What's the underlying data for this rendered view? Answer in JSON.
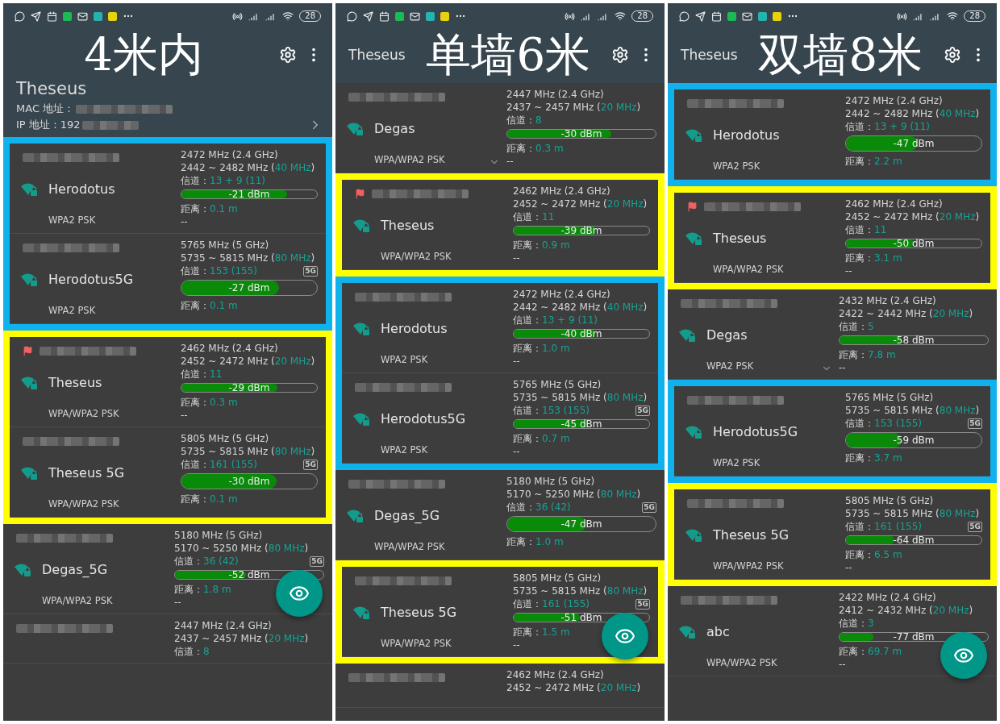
{
  "panels": [
    {
      "caption": "4米内",
      "status_bar": {
        "battery": "28"
      },
      "header": {
        "kind": "expanded",
        "title": "Theseus",
        "mac": "MAC 地址：",
        "ip": "IP 地址：192"
      },
      "groups": [
        {
          "color": "#10b2ee",
          "networks": [
            {
              "kind": "full",
              "flagged": false,
              "expandable": false,
              "name": "Herodotus",
              "security": "WPA2 PSK",
              "frequency": "2472 MHz (2.4 GHz)",
              "range": {
                "start": "2442 ~ 2482 MHz (",
                "bandwidth": "40 MHz",
                "end": ")"
              },
              "channel": {
                "label": "信道：",
                "value": "13 + 9 (11)"
              },
              "signal": {
                "level": 0.78,
                "reading": "-21 dBm"
              },
              "distance": {
                "label": "距离：",
                "value": "0.1 m"
              },
              "note": "--"
            },
            {
              "kind": "full",
              "flagged": false,
              "expandable": false,
              "name": "Herodotus5G",
              "security": "WPA2 PSK",
              "frequency": "5765 MHz (5 GHz)",
              "range": {
                "start": "5735 ~ 5815 MHz (",
                "bandwidth": "80 MHz",
                "end": ")"
              },
              "channel": {
                "label": "信道：",
                "value": "153 (155)"
              },
              "badge": "5G",
              "signal": {
                "level": 0.72,
                "reading": "-27 dBm"
              },
              "distance": {
                "label": "距离：",
                "value": "0.1 m"
              }
            }
          ]
        },
        {
          "color": "#ffff00",
          "networks": [
            {
              "kind": "full",
              "flagged": true,
              "expandable": false,
              "name": "Theseus",
              "security": "WPA/WPA2 PSK",
              "frequency": "2462 MHz (2.4 GHz)",
              "range": {
                "start": "2452 ~ 2472 MHz (",
                "bandwidth": "20 MHz",
                "end": ")"
              },
              "channel": {
                "label": "信道：",
                "value": "11"
              },
              "signal": {
                "level": 0.71,
                "reading": "-29 dBm"
              },
              "distance": {
                "label": "距离：",
                "value": "0.3 m"
              },
              "note": "--"
            },
            {
              "kind": "full",
              "flagged": false,
              "expandable": false,
              "name": "Theseus 5G",
              "security": "WPA/WPA2 PSK",
              "frequency": "5805 MHz (5 GHz)",
              "range": {
                "start": "5735 ~ 5815 MHz (",
                "bandwidth": "80 MHz",
                "end": ")"
              },
              "channel": {
                "label": "信道：",
                "value": "161 (155)"
              },
              "badge": "5G",
              "signal": {
                "level": 0.7,
                "reading": "-30 dBm"
              },
              "distance": {
                "label": "距离：",
                "value": "0.1 m"
              }
            }
          ]
        },
        {
          "networks": [
            {
              "kind": "full",
              "flagged": false,
              "expandable": false,
              "name": "Degas_5G",
              "security": "WPA/WPA2 PSK",
              "frequency": "5180 MHz (5 GHz)",
              "range": {
                "start": "5170 ~ 5250 MHz (",
                "bandwidth": "80 MHz",
                "end": ")"
              },
              "channel": {
                "label": "信道：",
                "value": "36 (42)"
              },
              "badge": "5G",
              "signal": {
                "level": 0.48,
                "reading": "-52 dBm"
              },
              "distance": {
                "label": "距离：",
                "value": "1.8 m"
              },
              "note": "--"
            },
            {
              "kind": "partial",
              "flagged": false,
              "expandable": false,
              "frequency": "2447 MHz (2.4 GHz)",
              "range": {
                "start": "2437 ~ 2457 MHz (",
                "bandwidth": "20 MHz",
                "end": ")"
              },
              "channel": {
                "label": "信道：",
                "value": "8"
              }
            }
          ]
        }
      ]
    },
    {
      "caption": "单墙6米",
      "status_bar": {
        "battery": "28"
      },
      "header": {
        "kind": "collapsed",
        "title": "Theseus"
      },
      "groups": [
        {
          "networks": [
            {
              "kind": "full",
              "flagged": false,
              "expandable": true,
              "name": "Degas",
              "security": "WPA/WPA2 PSK",
              "frequency": "2447 MHz (2.4 GHz)",
              "range": {
                "start": "2437 ~ 2457 MHz (",
                "bandwidth": "20 MHz",
                "end": ")"
              },
              "channel": {
                "label": "信道：",
                "value": "8"
              },
              "signal": {
                "level": 0.7,
                "reading": "-30 dBm"
              },
              "distance": {
                "label": "距离：",
                "value": "0.3 m"
              },
              "note": "--"
            }
          ]
        },
        {
          "color": "#ffff00",
          "networks": [
            {
              "kind": "full",
              "flagged": true,
              "expandable": false,
              "name": "Theseus",
              "security": "WPA/WPA2 PSK",
              "frequency": "2462 MHz (2.4 GHz)",
              "range": {
                "start": "2452 ~ 2472 MHz (",
                "bandwidth": "20 MHz",
                "end": ")"
              },
              "channel": {
                "label": "信道：",
                "value": "11"
              },
              "signal": {
                "level": 0.61,
                "reading": "-39 dBm"
              },
              "distance": {
                "label": "距离：",
                "value": "0.9 m"
              },
              "note": "--"
            }
          ]
        },
        {
          "color": "#10b2ee",
          "networks": [
            {
              "kind": "full",
              "flagged": false,
              "expandable": false,
              "name": "Herodotus",
              "security": "WPA2 PSK",
              "frequency": "2472 MHz (2.4 GHz)",
              "range": {
                "start": "2442 ~ 2482 MHz (",
                "bandwidth": "40 MHz",
                "end": ")"
              },
              "channel": {
                "label": "信道：",
                "value": "13 + 9 (11)"
              },
              "signal": {
                "level": 0.6,
                "reading": "-40 dBm"
              },
              "distance": {
                "label": "距离：",
                "value": "1.0 m"
              },
              "note": "--"
            },
            {
              "kind": "full",
              "flagged": false,
              "expandable": false,
              "name": "Herodotus5G",
              "security": "WPA2 PSK",
              "frequency": "5765 MHz (5 GHz)",
              "range": {
                "start": "5735 ~ 5815 MHz (",
                "bandwidth": "80 MHz",
                "end": ")"
              },
              "channel": {
                "label": "信道：",
                "value": "153 (155)"
              },
              "badge": "5G",
              "signal": {
                "level": 0.55,
                "reading": "-45 dBm"
              },
              "distance": {
                "label": "距离：",
                "value": "0.7 m"
              },
              "note": "--"
            }
          ]
        },
        {
          "networks": [
            {
              "kind": "full",
              "flagged": false,
              "expandable": false,
              "name": "Degas_5G",
              "security": "WPA/WPA2 PSK",
              "frequency": "5180 MHz (5 GHz)",
              "range": {
                "start": "5170 ~ 5250 MHz (",
                "bandwidth": "80 MHz",
                "end": ")"
              },
              "channel": {
                "label": "信道：",
                "value": "36 (42)"
              },
              "badge": "5G",
              "signal": {
                "level": 0.53,
                "reading": "-47 dBm"
              },
              "distance": {
                "label": "距离：",
                "value": "1.0 m"
              }
            }
          ]
        },
        {
          "color": "#ffff00",
          "networks": [
            {
              "kind": "full",
              "flagged": false,
              "expandable": false,
              "name": "Theseus 5G",
              "security": "WPA/WPA2 PSK",
              "frequency": "5805 MHz (5 GHz)",
              "range": {
                "start": "5735 ~ 5815 MHz (",
                "bandwidth": "80 MHz",
                "end": ")"
              },
              "channel": {
                "label": "信道：",
                "value": "161 (155)"
              },
              "badge": "5G",
              "signal": {
                "level": 0.49,
                "reading": "-51 dBm"
              },
              "distance": {
                "label": "距离：",
                "value": "1.5 m"
              },
              "note": "--"
            }
          ]
        },
        {
          "networks": [
            {
              "kind": "partial",
              "flagged": false,
              "expandable": false,
              "frequency": "2462 MHz (2.4 GHz)",
              "range": {
                "start": "2452 ~ 2472 MHz (",
                "bandwidth": "20 MHz",
                "end": ")"
              }
            }
          ]
        }
      ]
    },
    {
      "caption": "双墙8米",
      "status_bar": {
        "battery": "28"
      },
      "header": {
        "kind": "collapsed",
        "title": "Theseus"
      },
      "groups": [
        {
          "color": "#10b2ee",
          "networks": [
            {
              "kind": "full",
              "flagged": false,
              "expandable": false,
              "name": "Herodotus",
              "security": "WPA2 PSK",
              "frequency": "2472 MHz (2.4 GHz)",
              "range": {
                "start": "2442 ~ 2482 MHz (",
                "bandwidth": "40 MHz",
                "end": ")"
              },
              "channel": {
                "label": "信道：",
                "value": "13 + 9 (11)"
              },
              "signal": {
                "level": 0.53,
                "reading": "-47 dBm"
              },
              "distance": {
                "label": "距离：",
                "value": "2.2 m"
              }
            }
          ]
        },
        {
          "color": "#ffff00",
          "networks": [
            {
              "kind": "full",
              "flagged": true,
              "expandable": false,
              "name": "Theseus",
              "security": "WPA/WPA2 PSK",
              "frequency": "2462 MHz (2.4 GHz)",
              "range": {
                "start": "2452 ~ 2472 MHz (",
                "bandwidth": "20 MHz",
                "end": ")"
              },
              "channel": {
                "label": "信道：",
                "value": "11"
              },
              "signal": {
                "level": 0.5,
                "reading": "-50 dBm"
              },
              "distance": {
                "label": "距离：",
                "value": "3.1 m"
              },
              "note": "--"
            }
          ]
        },
        {
          "networks": [
            {
              "kind": "full",
              "flagged": false,
              "expandable": true,
              "name": "Degas",
              "security": "WPA2 PSK",
              "frequency": "2432 MHz (2.4 GHz)",
              "range": {
                "start": "2422 ~ 2442 MHz (",
                "bandwidth": "20 MHz",
                "end": ")"
              },
              "channel": {
                "label": "信道：",
                "value": "5"
              },
              "signal": {
                "level": 0.42,
                "reading": "-58 dBm"
              },
              "distance": {
                "label": "距离：",
                "value": "7.8 m"
              },
              "note": "--"
            }
          ]
        },
        {
          "color": "#10b2ee",
          "networks": [
            {
              "kind": "full",
              "flagged": false,
              "expandable": false,
              "name": "Herodotus5G",
              "security": "WPA2 PSK",
              "frequency": "5765 MHz (5 GHz)",
              "range": {
                "start": "5735 ~ 5815 MHz (",
                "bandwidth": "80 MHz",
                "end": ")"
              },
              "channel": {
                "label": "信道：",
                "value": "153 (155)"
              },
              "badge": "5G",
              "signal": {
                "level": 0.41,
                "reading": "-59 dBm"
              },
              "distance": {
                "label": "距离：",
                "value": "3.7 m"
              }
            }
          ]
        },
        {
          "color": "#ffff00",
          "networks": [
            {
              "kind": "full",
              "flagged": false,
              "expandable": false,
              "name": "Theseus 5G",
              "security": "WPA/WPA2 PSK",
              "frequency": "5805 MHz (5 GHz)",
              "range": {
                "start": "5735 ~ 5815 MHz (",
                "bandwidth": "80 MHz",
                "end": ")"
              },
              "channel": {
                "label": "信道：",
                "value": "161 (155)"
              },
              "badge": "5G",
              "signal": {
                "level": 0.36,
                "reading": "-64 dBm"
              },
              "distance": {
                "label": "距离：",
                "value": "6.5 m"
              },
              "note": "--"
            }
          ]
        },
        {
          "networks": [
            {
              "kind": "full",
              "flagged": false,
              "expandable": false,
              "name": "abc",
              "security": "WPA/WPA2 PSK",
              "frequency": "2422 MHz (2.4 GHz)",
              "range": {
                "start": "2412 ~ 2432 MHz (",
                "bandwidth": "20 MHz",
                "end": ")"
              },
              "channel": {
                "label": "信道：",
                "value": "3"
              },
              "signal": {
                "level": 0.23,
                "reading": "-77 dBm"
              },
              "distance": {
                "label": "距离：",
                "value": "69.7 m"
              },
              "note": "--"
            }
          ]
        }
      ]
    }
  ]
}
